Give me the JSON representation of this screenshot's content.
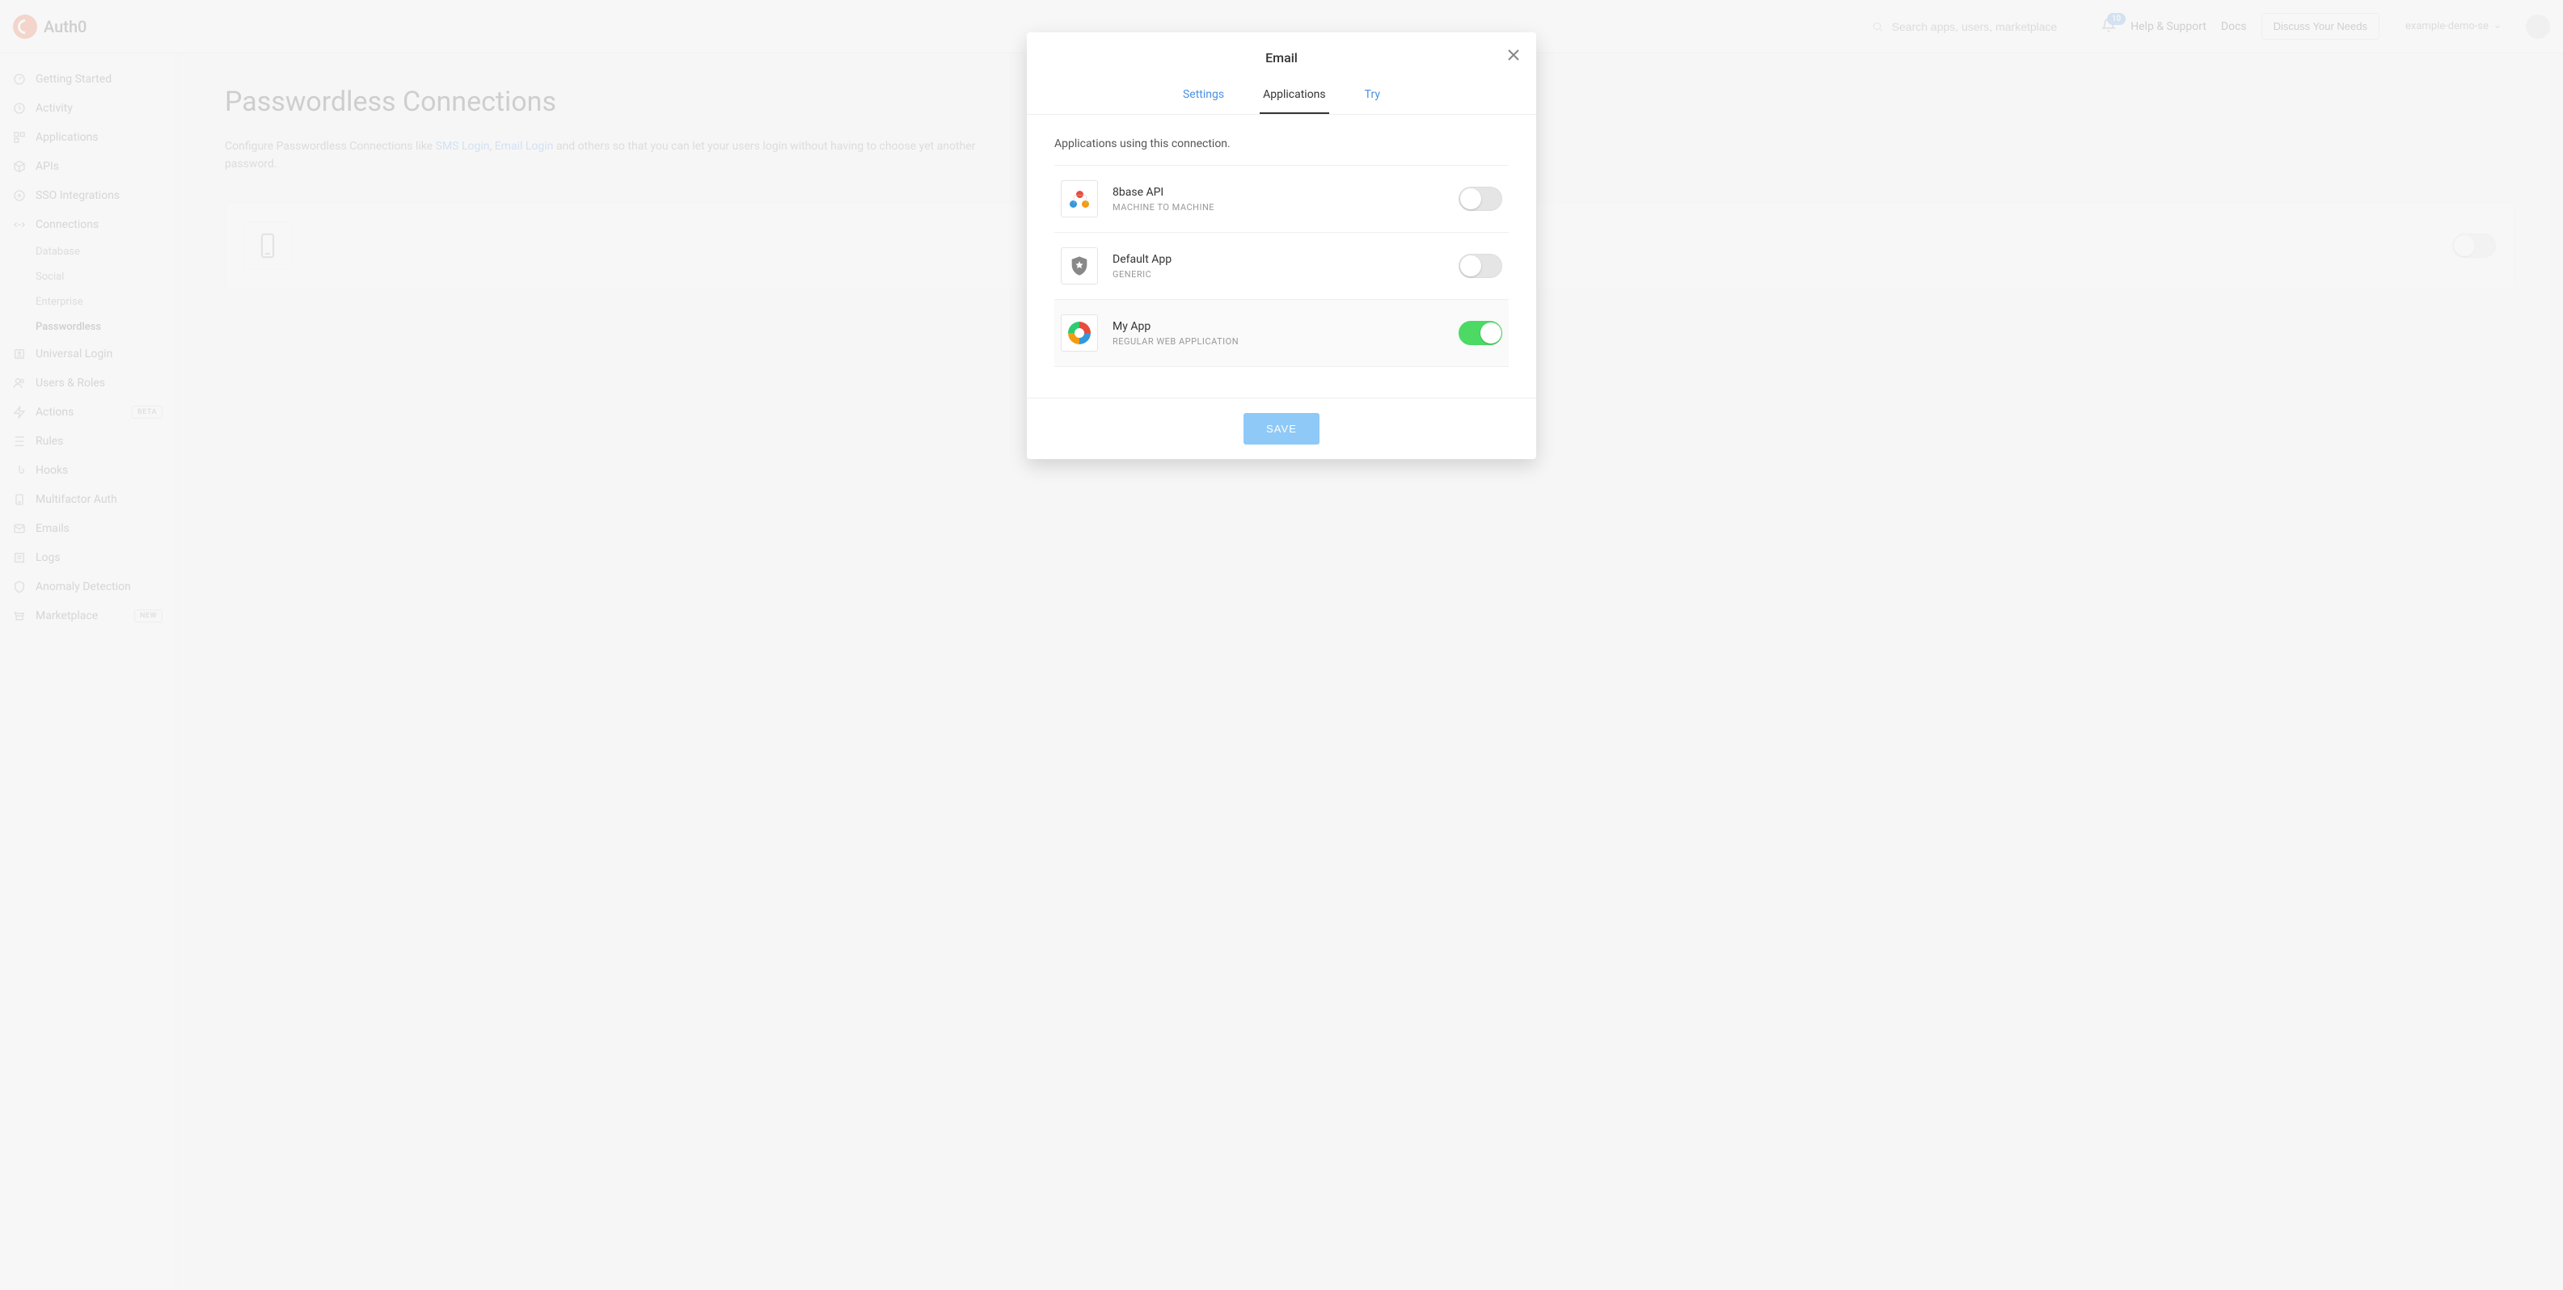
{
  "brand": "Auth0",
  "search": {
    "placeholder": "Search apps, users, marketplace"
  },
  "notifications": {
    "count": "10"
  },
  "topnav": {
    "help": "Help & Support",
    "docs": "Docs",
    "cta": "Discuss Your Needs",
    "tenant": "example-demo-se"
  },
  "sidebar": {
    "items": [
      {
        "label": "Getting Started"
      },
      {
        "label": "Activity"
      },
      {
        "label": "Applications"
      },
      {
        "label": "APIs"
      },
      {
        "label": "SSO Integrations"
      },
      {
        "label": "Connections"
      },
      {
        "label": "Universal Login"
      },
      {
        "label": "Users & Roles"
      },
      {
        "label": "Actions",
        "tag": "BETA"
      },
      {
        "label": "Rules"
      },
      {
        "label": "Hooks"
      },
      {
        "label": "Multifactor Auth"
      },
      {
        "label": "Emails"
      },
      {
        "label": "Logs"
      },
      {
        "label": "Anomaly Detection"
      },
      {
        "label": "Marketplace",
        "tag": "NEW"
      }
    ],
    "connections_sub": [
      {
        "label": "Database"
      },
      {
        "label": "Social"
      },
      {
        "label": "Enterprise"
      },
      {
        "label": "Passwordless"
      }
    ]
  },
  "page": {
    "title": "Passwordless Connections",
    "desc_prefix": "Configure Passwordless Connections like ",
    "desc_link1": "SMS Login",
    "desc_mid": ", ",
    "desc_link2": "Email Login",
    "desc_suffix": " and others so that you can let your users login without having to choose yet another password."
  },
  "modal": {
    "title": "Email",
    "tabs": {
      "settings": "Settings",
      "applications": "Applications",
      "try": "Try"
    },
    "subtext": "Applications using this connection.",
    "apps": [
      {
        "name": "8base API",
        "type": "MACHINE TO MACHINE",
        "enabled": false
      },
      {
        "name": "Default App",
        "type": "GENERIC",
        "enabled": false
      },
      {
        "name": "My App",
        "type": "REGULAR WEB APPLICATION",
        "enabled": true
      }
    ],
    "save": "SAVE"
  }
}
